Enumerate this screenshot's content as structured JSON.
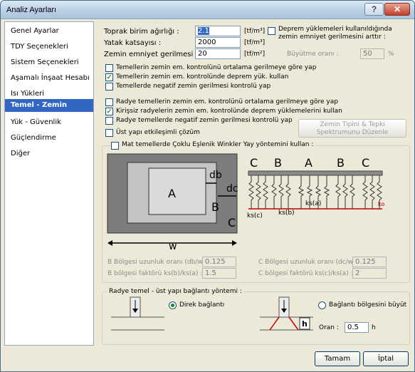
{
  "window": {
    "title": "Analiz Ayarları",
    "help_glyph": "?",
    "close_glyph": "✕"
  },
  "sidebar": {
    "items": [
      {
        "label": "Genel Ayarlar"
      },
      {
        "label": "TDY Seçenekleri"
      },
      {
        "label": "Sistem Seçenekleri"
      },
      {
        "label": "Aşamalı İnşaat Hesabı"
      },
      {
        "label": "Isı Yükleri"
      },
      {
        "label": "Temel - Zemin"
      },
      {
        "label": "Yük - Güvenlik"
      },
      {
        "label": "Güçlendirme"
      },
      {
        "label": "Diğer"
      }
    ],
    "selected_index": 5
  },
  "soil": {
    "unit_weight_label": "Toprak birim ağırlığı :",
    "unit_weight_value": "2.1",
    "unit_weight_unit": "[tf/m³]",
    "bed_label": "Yatak katsayısı :",
    "bed_value": "2000",
    "bed_unit": "[tf/m³]",
    "allow_label": "Zemin emniyet gerilmesi :",
    "allow_value": "20",
    "allow_unit": "[tf/m²]"
  },
  "eq": {
    "label": "Deprem yüklemeleri kullanıldığında zemin emniyet gerilmesini arttır :",
    "factor_label": "Büyütme oranı :",
    "factor_value": "50",
    "factor_unit": "%"
  },
  "checks1": [
    {
      "label": "Temellerin zemin em. kontrolünü ortalama gerilmeye göre yap",
      "checked": false
    },
    {
      "label": "Temellerin zemin em. kontrolünde deprem yük. kullan",
      "checked": true
    },
    {
      "label": "Temellerde negatif zemin gerilmesi kontrolü yap",
      "checked": false
    }
  ],
  "checks2": [
    {
      "label": "Radye temellerin zemin em. kontrolünü ortalama gerilmeye göre yap",
      "checked": false
    },
    {
      "label": "Kirişsiz radyelerin zemin em. kontrolünde deprem yüklemelerini kullan",
      "checked": true
    },
    {
      "label": "Radye temellerde negatif zemin gerilmesi kontrolü yap",
      "checked": false
    }
  ],
  "superstructure_check": {
    "label": "Üst yapı etkileşimli çözüm",
    "checked": false
  },
  "spectrum_button": {
    "label": "Zemin Tipini & Tepki Spektrumunu Düzenle"
  },
  "winkler": {
    "title": "Mat temellerde Çoklu Eşlenik Winkler Yay yöntemini kullan :",
    "checked": false,
    "plan": {
      "zone_a": "A",
      "zone_b": "B",
      "zone_c": "C",
      "db": "db",
      "dc": "dc",
      "w": "w"
    },
    "section": {
      "labels": [
        "C",
        "B",
        "A",
        "B",
        "C"
      ],
      "ks_c": "ks(c)",
      "ks_b": "ks(b)",
      "ks_a": "ks(a)",
      "ko": "ko"
    },
    "b_ratio_label": "B Bölgesi uzunluk oranı (db/w) :",
    "b_ratio_value": "0.125",
    "c_ratio_label": "C Bölgesi uzunluk oranı (dc/w) :",
    "c_ratio_value": "0.125",
    "b_factor_label": "B bölgesi faktörü ks(b)/ks(a) :",
    "b_factor_value": "1.5",
    "c_factor_label": "C bölgesi faktörü ks(c)/ks(a) :",
    "c_factor_value": "2"
  },
  "connection": {
    "title": "Radye temel - üst yapı bağlantı yöntemi :",
    "direct_label": "Direk bağlantı",
    "direct_selected": true,
    "enlarge_label": "Bağlantı bölgesini büyüt",
    "enlarge_selected": false,
    "ratio_label": "Oran :",
    "ratio_value": "0.5",
    "ratio_unit": "h",
    "h_label": "h"
  },
  "buttons": {
    "ok": "Tamam",
    "cancel": "İptal"
  }
}
